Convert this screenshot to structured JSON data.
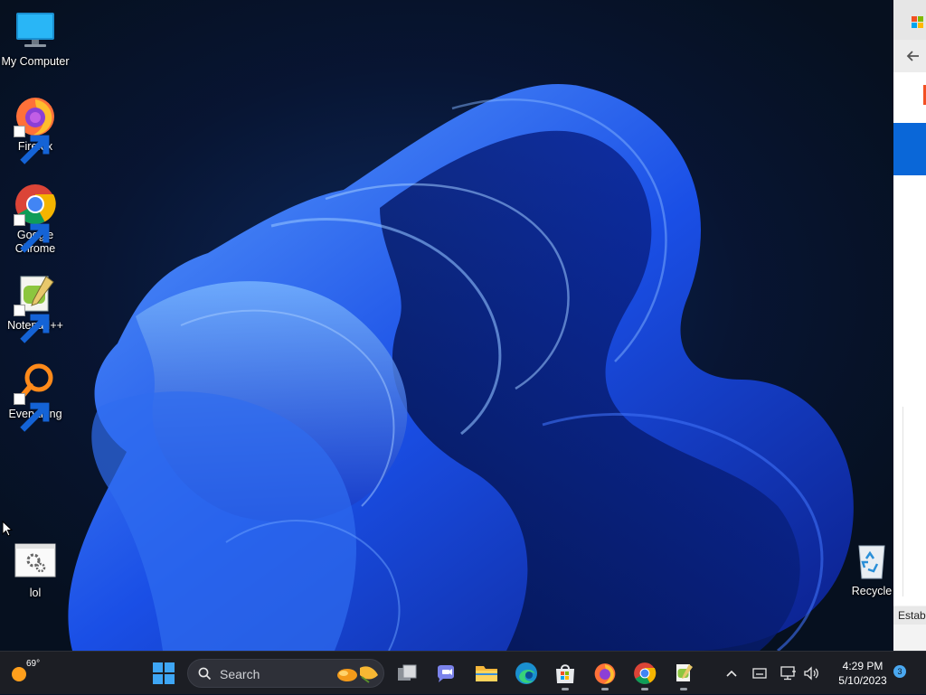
{
  "desktop": {
    "icons": [
      {
        "label": "My Computer",
        "icon": "monitor-icon"
      },
      {
        "label": "Firefox",
        "icon": "firefox-icon"
      },
      {
        "label": "Google Chrome",
        "icon": "chrome-icon"
      },
      {
        "label": "Notepad++",
        "icon": "notepadpp-icon"
      },
      {
        "label": "Everything",
        "icon": "everything-search-icon"
      },
      {
        "label": "lol",
        "icon": "settings-window-icon"
      },
      {
        "label": "Recycle",
        "icon": "recycle-bin-icon"
      }
    ]
  },
  "side_window": {
    "status_text": "Establ"
  },
  "taskbar": {
    "weather_temp": "69°",
    "search_placeholder": "Search",
    "clock_time": "4:29 PM",
    "clock_date": "5/10/2023",
    "notification_count": "3",
    "pinned": [
      "task-view-icon",
      "teams-chat-icon",
      "file-explorer-icon",
      "edge-icon",
      "store-icon",
      "firefox-icon",
      "chrome-icon",
      "notepadpp-icon"
    ],
    "tray": [
      "chevron-up-icon",
      "keyboard-icon",
      "network-icon",
      "volume-icon"
    ]
  },
  "colors": {
    "taskbar_bg": "#1c1e24",
    "accent": "#4aa8f0",
    "desktop_bg": "#071327",
    "wallpaper_bloom": "#1a4fe6"
  }
}
